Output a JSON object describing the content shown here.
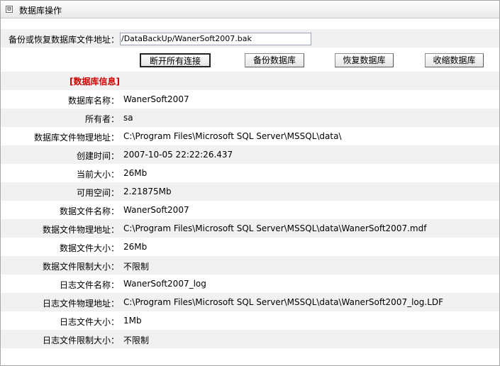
{
  "header": {
    "collapse_symbol": "⊟",
    "title": "数据库操作"
  },
  "backup": {
    "path_label": "备份或恢复数据库文件地址：",
    "path_value": "/DataBackUp/WanerSoft2007.bak"
  },
  "buttons": {
    "disconnect": "断开所有连接",
    "backup": "备份数据库",
    "restore": "恢复数据库",
    "shrink": "收缩数据库"
  },
  "info": {
    "section_title": "[数据库信息]",
    "rows": [
      {
        "label": "数据库名称：",
        "value": "WanerSoft2007"
      },
      {
        "label": "所有者：",
        "value": "sa"
      },
      {
        "label": "数据库文件物理地址：",
        "value": "C:\\Program Files\\Microsoft SQL Server\\MSSQL\\data\\"
      },
      {
        "label": "创建时间：",
        "value": "2007-10-05 22:22:26.437"
      },
      {
        "label": "当前大小：",
        "value": "26Mb"
      },
      {
        "label": "可用空间：",
        "value": "2.21875Mb"
      },
      {
        "label": "数据文件名称：",
        "value": "WanerSoft2007"
      },
      {
        "label": "数据文件物理地址：",
        "value": "C:\\Program Files\\Microsoft SQL Server\\MSSQL\\data\\WanerSoft2007.mdf"
      },
      {
        "label": "数据文件大小：",
        "value": "26Mb"
      },
      {
        "label": "数据文件限制大小：",
        "value": "不限制"
      },
      {
        "label": "日志文件名称：",
        "value": "WanerSoft2007_log"
      },
      {
        "label": "日志文件物理地址：",
        "value": "C:\\Program Files\\Microsoft SQL Server\\MSSQL\\data\\WanerSoft2007_log.LDF"
      },
      {
        "label": "日志文件大小：",
        "value": "1Mb"
      },
      {
        "label": "日志文件限制大小：",
        "value": "不限制"
      }
    ]
  }
}
